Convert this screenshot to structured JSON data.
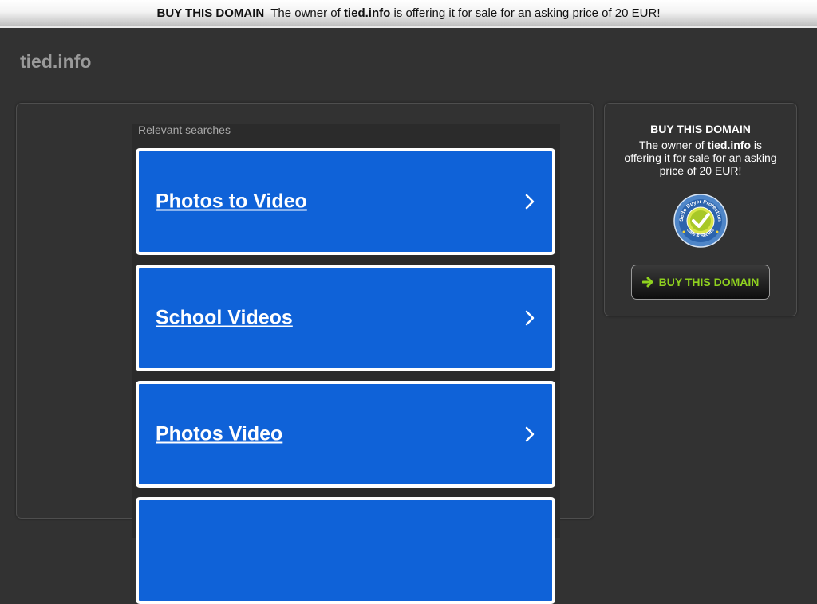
{
  "banner": {
    "buy_label": "BUY THIS DOMAIN",
    "text_pre": "The owner of",
    "domain": "tied.info",
    "text_post": "is offering it for sale for an asking price of 20 EUR!"
  },
  "site": {
    "title": "tied.info"
  },
  "results": {
    "heading": "Relevant searches",
    "items": [
      {
        "label": "Photos to Video"
      },
      {
        "label": "School Videos"
      },
      {
        "label": "Photos Video"
      }
    ]
  },
  "side": {
    "title": "BUY THIS DOMAIN",
    "text_pre": "The owner of",
    "domain": "tied.info",
    "text_post": "is offering it for sale for an asking price of 20 EUR!",
    "badge_top_text": "Sedo Buyer Protection",
    "badge_bottom_text": "Safe & Secure",
    "button_label": "BUY THIS DOMAIN",
    "button_icon": "arrow-right-icon"
  },
  "colors": {
    "page_bg": "#323232",
    "card_blue": "#0f62d8",
    "button_green": "#8fd11f"
  }
}
